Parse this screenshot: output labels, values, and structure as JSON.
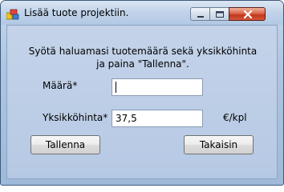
{
  "window": {
    "title": "Lisää tuote projektiin.",
    "icon": "app-icon"
  },
  "titlebar_controls": {
    "minimize_icon": "minimize-icon",
    "maximize_icon": "maximize-icon",
    "close_icon": "close-icon"
  },
  "form": {
    "instruction": "Syötä haluamasi tuotemäärä sekä yksikköhinta\nja paina \"Tallenna\".",
    "quantity_label": "Määrä*",
    "quantity_value": "",
    "unit_price_label": "Yksikköhinta*",
    "unit_price_value": "37,5",
    "unit_label": "€/kpl"
  },
  "buttons": {
    "save_label": "Tallenna",
    "back_label": "Takaisin"
  },
  "colors": {
    "close_button": "#c2371c",
    "window_frame": "#aec6e2",
    "client_area": "#b6c9e4"
  }
}
